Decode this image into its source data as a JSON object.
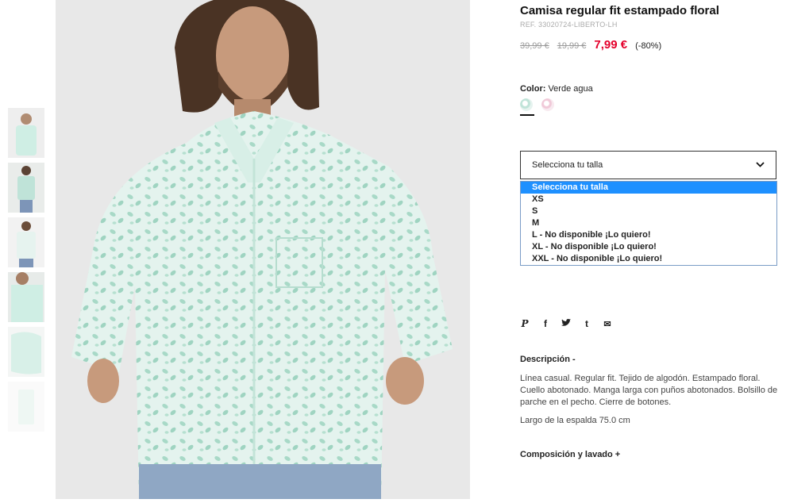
{
  "product": {
    "title": "Camisa regular fit estampado floral",
    "ref": "REF. 33020724-LIBERTO-LH",
    "old_price_1": "39,99 €",
    "old_price_2": "19,99 €",
    "sale_price": "7,99 €",
    "discount": "(-80%)"
  },
  "color": {
    "label": "Color:",
    "value": "Verde agua",
    "swatches": [
      "verde-agua",
      "rosa"
    ]
  },
  "size": {
    "placeholder": "Selecciona tu talla",
    "options": [
      "Selecciona tu talla",
      "XS",
      "S",
      "M",
      "L - No disponible ¡Lo quiero!",
      "XL - No disponible ¡Lo quiero!",
      "XXL - No disponible ¡Lo quiero!"
    ]
  },
  "share": {
    "pinterest": "P",
    "facebook": "f",
    "twitter": "t",
    "tumblr": "t",
    "email": "✉"
  },
  "description": {
    "heading": "Descripción -",
    "body": "Línea casual. Regular fit. Tejido de algodón. Estampado floral. Cuello abotonado. Manga larga con puños abotonados. Bolsillo de parche en el pecho. Cierre de botones.",
    "length": "Largo de la espalda 75.0 cm"
  },
  "composition": {
    "heading": "Composición y lavado +"
  },
  "colors": {
    "sale": "#e4002b",
    "highlight": "#1e90ff",
    "shirt": "#cfeee4"
  }
}
